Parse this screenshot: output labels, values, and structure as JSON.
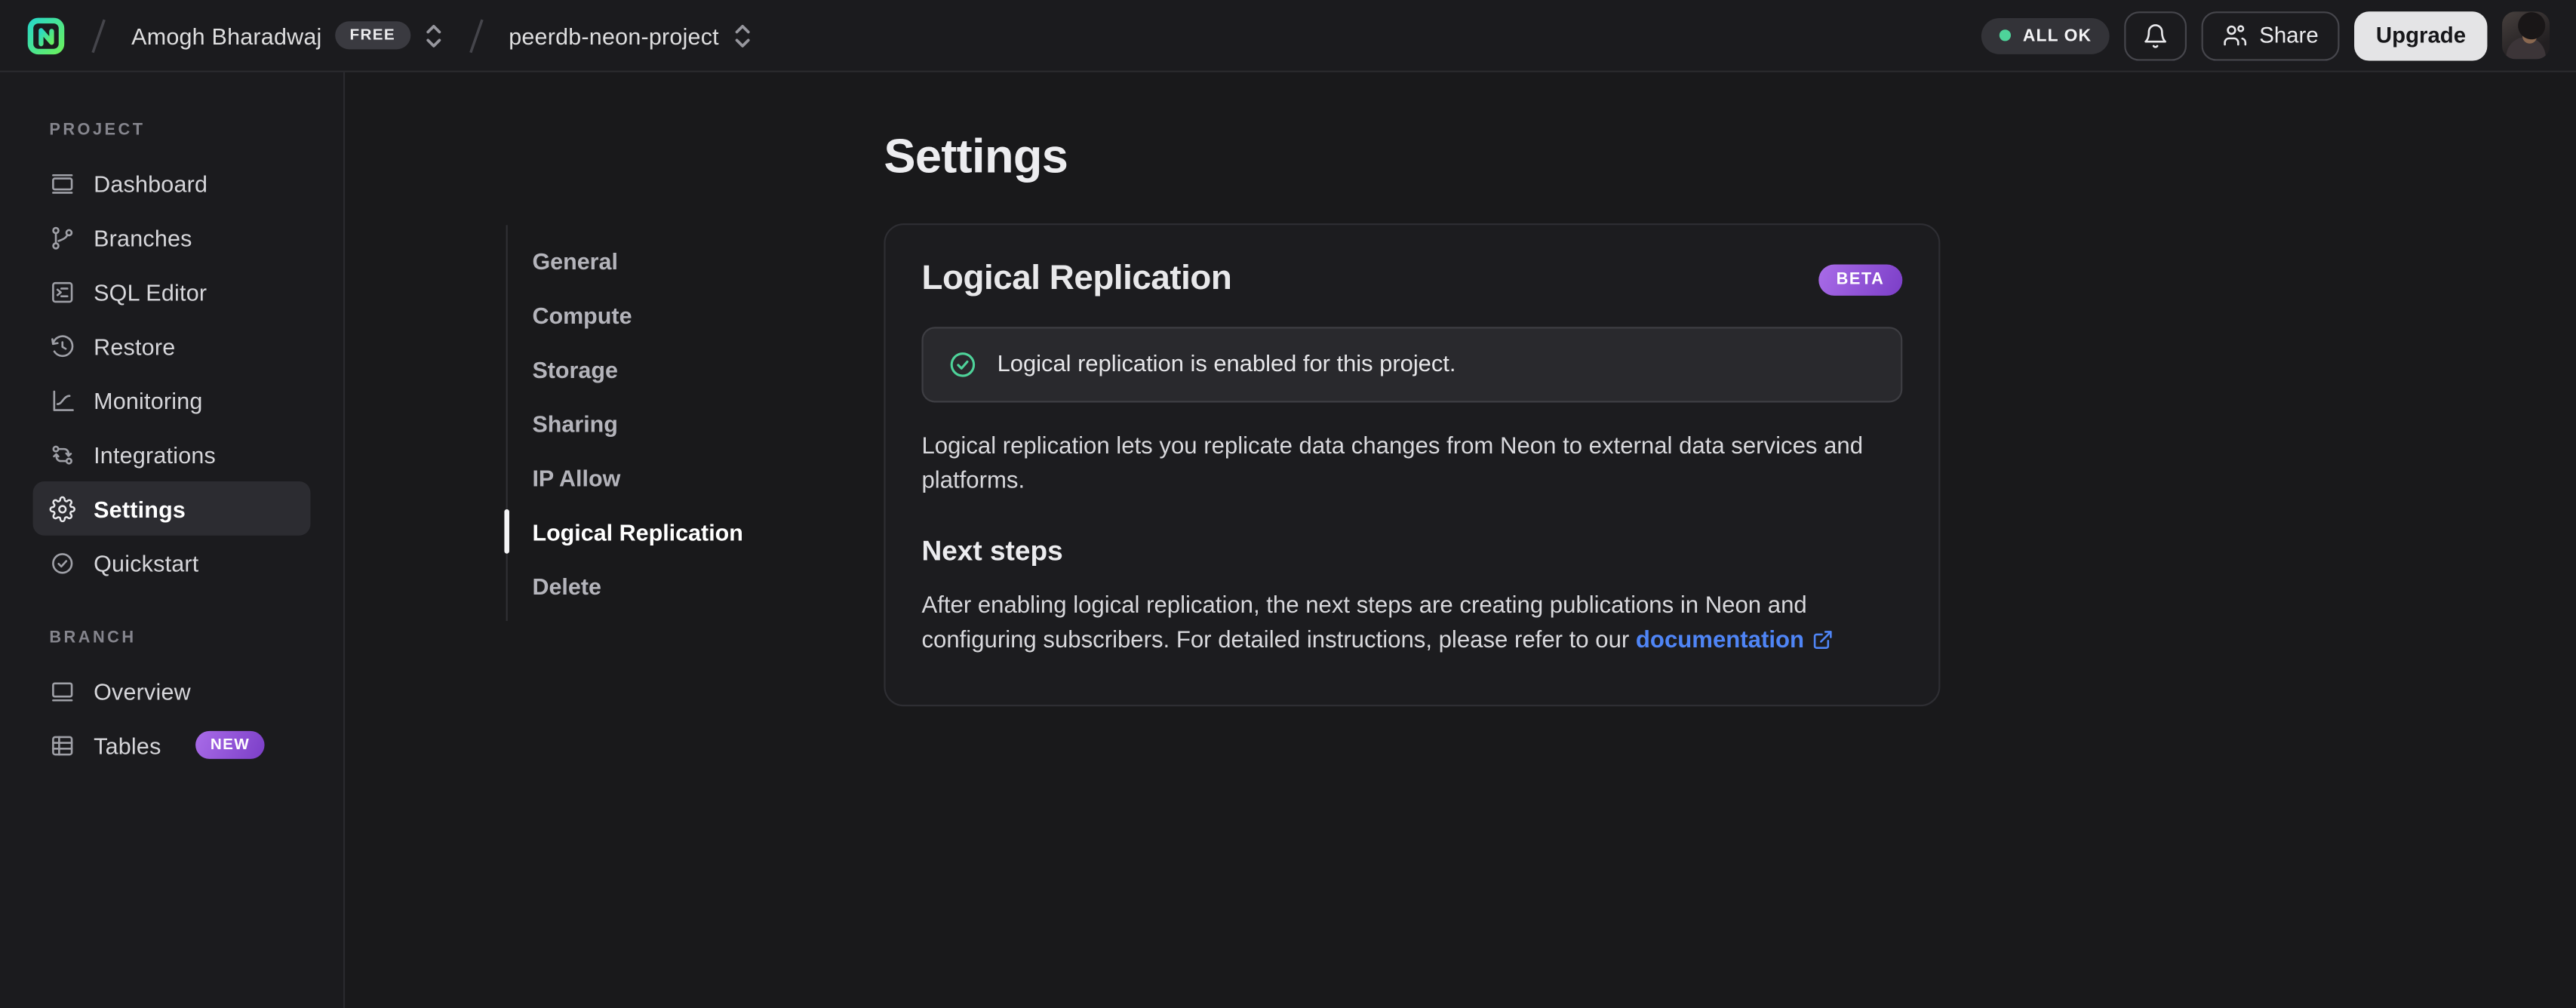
{
  "topbar": {
    "org_name": "Amogh Bharadwaj",
    "org_badge": "FREE",
    "project_name": "peerdb-neon-project",
    "status_label": "ALL OK",
    "share_label": "Share",
    "upgrade_label": "Upgrade"
  },
  "sidebar": {
    "sections": [
      {
        "label": "PROJECT",
        "items": [
          {
            "label": "Dashboard"
          },
          {
            "label": "Branches"
          },
          {
            "label": "SQL Editor"
          },
          {
            "label": "Restore"
          },
          {
            "label": "Monitoring"
          },
          {
            "label": "Integrations"
          },
          {
            "label": "Settings"
          },
          {
            "label": "Quickstart"
          }
        ]
      },
      {
        "label": "BRANCH",
        "items": [
          {
            "label": "Overview"
          },
          {
            "label": "Tables",
            "badge": "NEW"
          }
        ]
      }
    ]
  },
  "settings_nav": {
    "items": [
      "General",
      "Compute",
      "Storage",
      "Sharing",
      "IP Allow",
      "Logical Replication",
      "Delete"
    ],
    "active": "Logical Replication"
  },
  "main": {
    "page_title": "Settings",
    "card": {
      "heading": "Logical Replication",
      "badge": "BETA",
      "alert_text": "Logical replication is enabled for this project.",
      "description": "Logical replication lets you replicate data changes from Neon to external data services and platforms.",
      "next_steps_heading": "Next steps",
      "instructions_prefix": "After enabling logical replication, the next steps are creating publications in Neon and configuring subscribers. For detailed instructions, please refer to our ",
      "doc_link_label": "documentation"
    }
  },
  "colors": {
    "brand_green": "#4ed39a",
    "badge_purple_start": "#a96ce8",
    "badge_purple_end": "#7b3ec7",
    "link_blue": "#4f85f6",
    "upgrade_bg": "#e4e4e6",
    "background": "#19191b"
  }
}
